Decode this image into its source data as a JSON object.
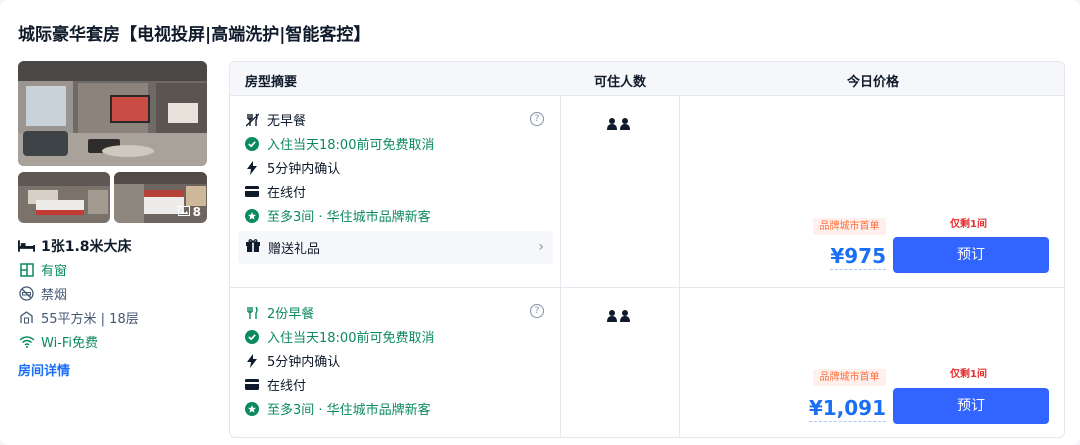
{
  "room": {
    "title": "城际豪华套房【电视投屏|高端洗护|智能客控】",
    "photo_count": "8",
    "bed": "1张1.8米大床",
    "window": "有窗",
    "smoking": "禁烟",
    "area_floor": "55平方米 | 18层",
    "wifi": "Wi-Fi免费",
    "details_link": "房间详情"
  },
  "table": {
    "headers": {
      "summary": "房型摘要",
      "guests": "可住人数",
      "price": "今日价格"
    }
  },
  "offers": [
    {
      "meal": "无早餐",
      "cancel": "入住当天18:00前可免费取消",
      "confirm": "5分钟内确认",
      "payment": "在线付",
      "member": "至多3间 · 华住城市品牌新客",
      "gift": "赠送礼品",
      "guest_count": 2,
      "badge": "品牌城市首单",
      "remaining": "仅剩1间",
      "price": "¥975",
      "book_label": "预订"
    },
    {
      "meal": "2份早餐",
      "cancel": "入住当天18:00前可免费取消",
      "confirm": "5分钟内确认",
      "payment": "在线付",
      "member": "至多3间 · 华住城市品牌新客",
      "guest_count": 2,
      "badge": "品牌城市首单",
      "remaining": "仅剩1间",
      "price": "¥1,091",
      "book_label": "预订"
    }
  ],
  "icons": {
    "meal_none": "no-breakfast-icon",
    "meal": "breakfast-icon",
    "cancel": "check-circle-icon",
    "confirm": "lightning-icon",
    "payment": "card-icon",
    "member": "star-badge-icon",
    "gift": "gift-icon",
    "guest": "person-icon"
  },
  "colors": {
    "accent": "#1b6ff5",
    "button": "#3264ff",
    "green": "#0b8a5c",
    "badge_text": "#ff6f3c",
    "alert": "#e62e2e"
  }
}
